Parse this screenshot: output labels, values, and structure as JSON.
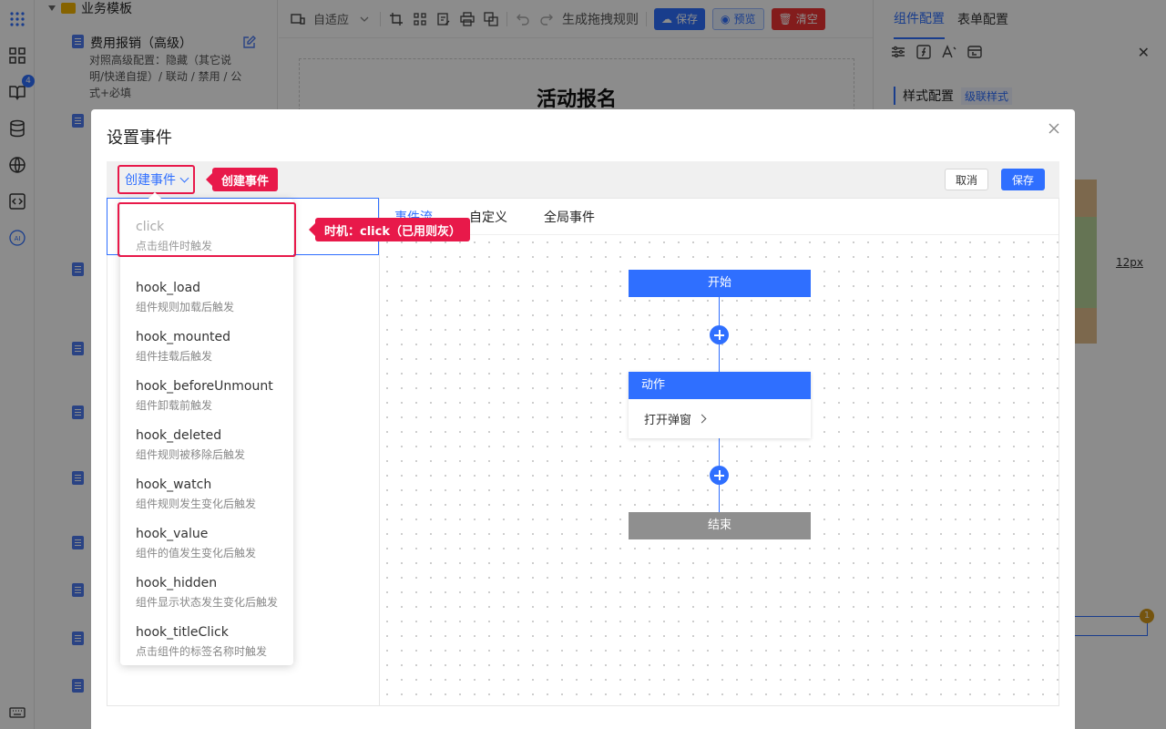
{
  "workspace": {
    "folder_label": "业务模板",
    "template_title": "费用报销（高级）",
    "template_desc": "对照高级配置：隐藏（其它说明/快递自提）/ 联动 / 禁用 / 公式+必填",
    "rail_badge": "4"
  },
  "toolbar": {
    "adapt_label": "自适应",
    "generate_label": "生成拖拽规则",
    "save_label": "保存",
    "preview_label": "预览",
    "clear_label": "清空"
  },
  "canvas": {
    "form_title": "活动报名"
  },
  "right_panel": {
    "tab_component": "组件配置",
    "tab_form": "表单配置",
    "style_config": "样式配置",
    "cascade_style": "级联样式",
    "size_value": "12px",
    "badge": "1"
  },
  "modal": {
    "title": "设置事件",
    "create_event": "创建事件",
    "cancel_label": "取消",
    "save_label": "保存",
    "tabs": [
      {
        "label": "事件流",
        "active": true
      },
      {
        "label": "自定义",
        "active": false
      },
      {
        "label": "全局事件",
        "active": false
      }
    ]
  },
  "callouts": {
    "create": "创建事件",
    "timing": "时机：click（已用则灰）"
  },
  "events": [
    {
      "name": "click",
      "desc": "点击组件时触发",
      "disabled": true
    },
    {
      "name": "hook_load",
      "desc": "组件规则加载后触发",
      "disabled": false
    },
    {
      "name": "hook_mounted",
      "desc": "组件挂载后触发",
      "disabled": false
    },
    {
      "name": "hook_beforeUnmount",
      "desc": "组件卸载前触发",
      "disabled": false
    },
    {
      "name": "hook_deleted",
      "desc": "组件规则被移除后触发",
      "disabled": false
    },
    {
      "name": "hook_watch",
      "desc": "组件规则发生变化后触发",
      "disabled": false
    },
    {
      "name": "hook_value",
      "desc": "组件的值发生变化后触发",
      "disabled": false
    },
    {
      "name": "hook_hidden",
      "desc": "组件显示状态发生变化后触发",
      "disabled": false
    },
    {
      "name": "hook_titleClick",
      "desc": "点击组件的标签名称时触发",
      "disabled": false
    }
  ],
  "flow": {
    "start_label": "开始",
    "action_label": "动作",
    "action_item": "打开弹窗",
    "end_label": "结束"
  },
  "colors": {
    "primary": "#2f6fff",
    "annotation": "#e8194a"
  }
}
